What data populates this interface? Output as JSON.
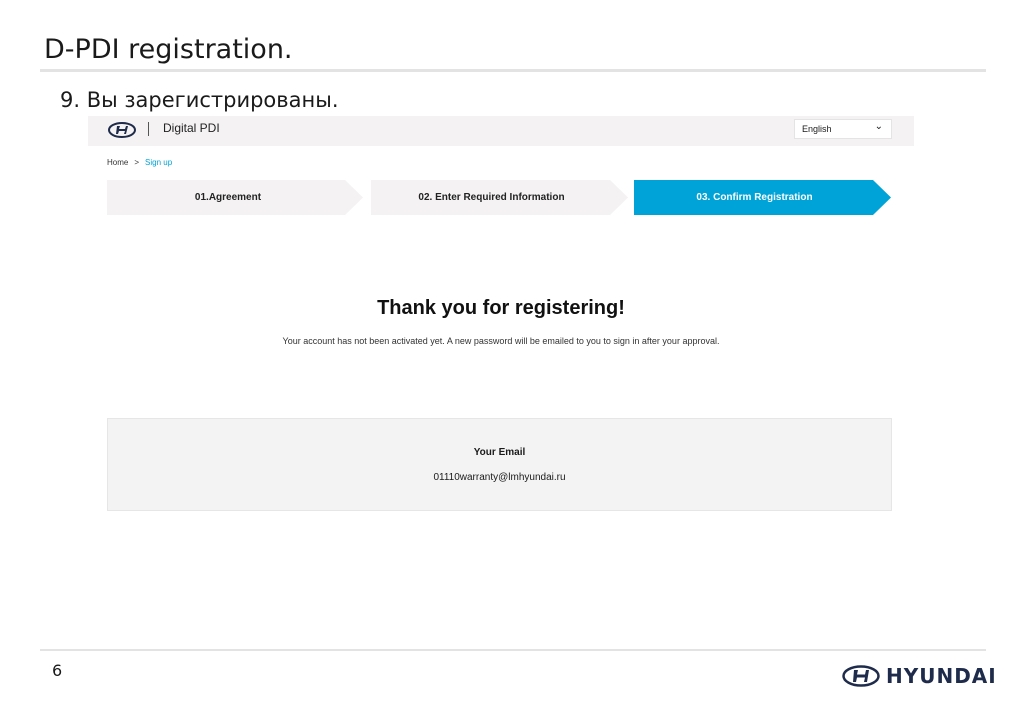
{
  "slide": {
    "title": "D-PDI registration.",
    "subtitle": "9. Вы зарегистрированы.",
    "page_number": "6",
    "brand_name": "HYUNDAI"
  },
  "app": {
    "name": "Digital PDI",
    "language": {
      "selected": "English"
    },
    "breadcrumb": {
      "home": "Home",
      "separator": ">",
      "current": "Sign up"
    },
    "steps": [
      {
        "label": "01.Agreement",
        "active": false
      },
      {
        "label": "02. Enter Required Information",
        "active": false
      },
      {
        "label": "03. Confirm Registration",
        "active": true
      }
    ],
    "confirmation": {
      "heading": "Thank you for registering!",
      "message": "Your account has not been activated yet. A new password will be emailed to you to sign in after your approval.",
      "email_label": "Your Email",
      "email_value": "01110warranty@lmhyundai.ru"
    }
  },
  "colors": {
    "accent": "#00a3d7",
    "step_inactive": "#f4f2f2",
    "brand": "#1f2b4b"
  },
  "icons": {
    "logo": "hyundai-logo-icon",
    "dropdown": "chevron-down-icon"
  }
}
